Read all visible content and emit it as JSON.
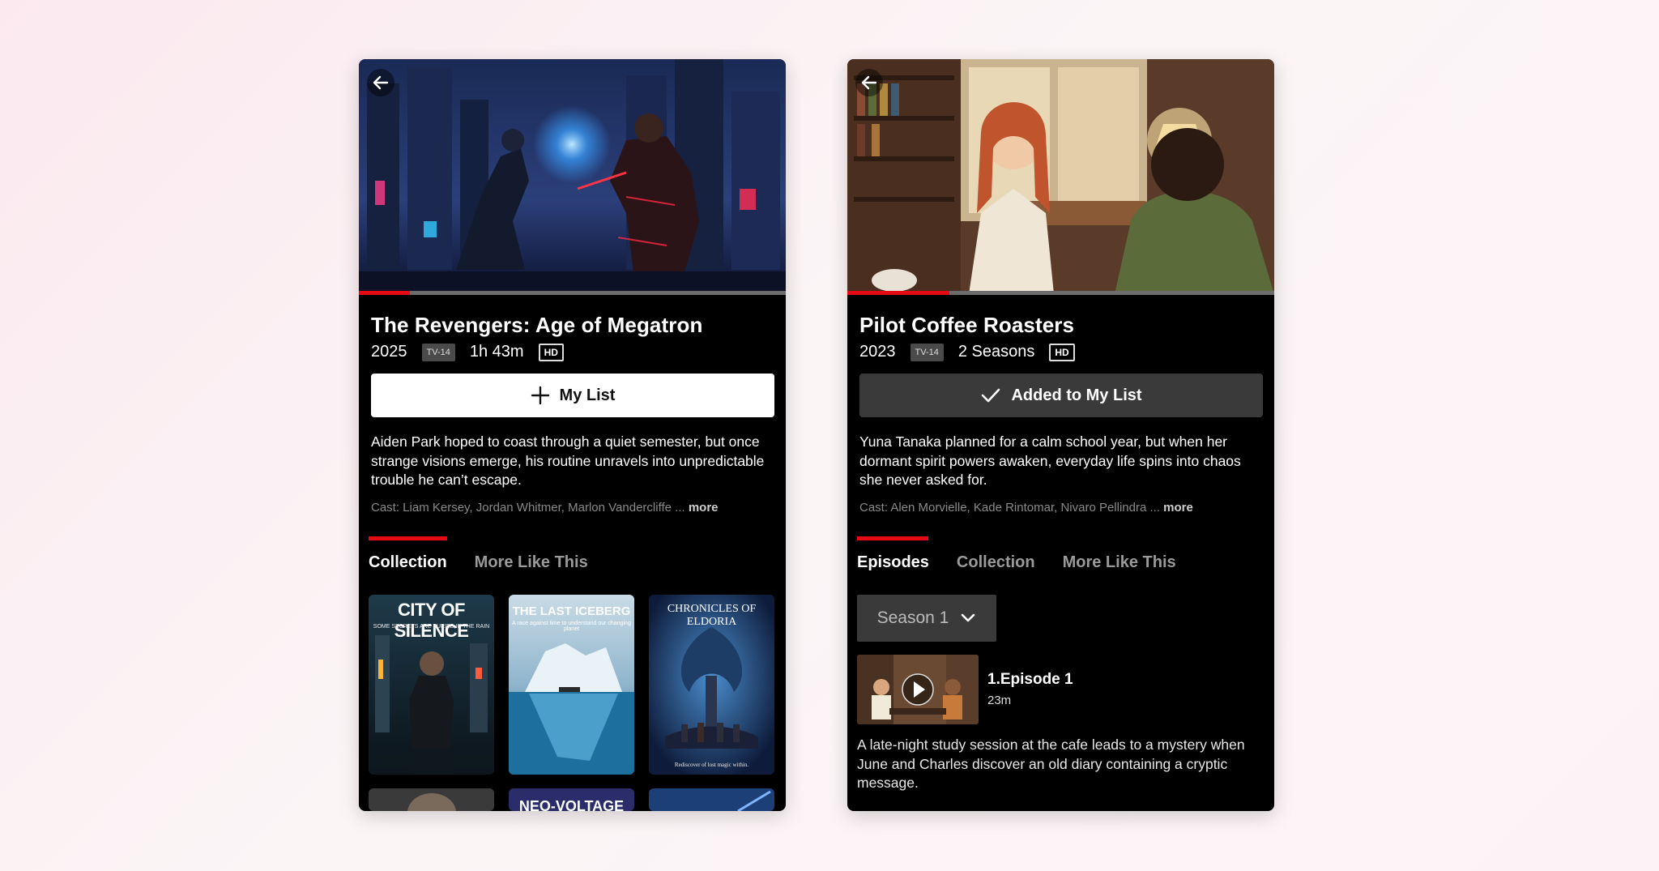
{
  "left_screen": {
    "title": "The Revengers: Age of Megatron",
    "year": "2025",
    "rating": "TV-14",
    "duration": "1h 43m",
    "quality": "HD",
    "list_button": "My List",
    "description": "Aiden Park hoped to coast through a quiet semester, but once strange visions emerge, his routine unravels into unpredictable trouble he can’t escape.",
    "cast": "Cast: Liam Kersey, Jordan Whitmer, Marlon Vandercliffe ...",
    "cast_more": "more",
    "tabs": [
      "Collection",
      "More Like This"
    ],
    "active_tab": "Collection",
    "playback_progress": 0.12,
    "posters": [
      {
        "title": "CITY OF SILENCE",
        "subtitle": "SOME SECRETS ARE BURIED IN THE RAIN"
      },
      {
        "title": "THE LAST ICEBERG",
        "subtitle": "A race against time to understand our changing planet"
      },
      {
        "title": "CHRONICLES OF ELDORIA",
        "subtitle": "Rediscover of lost magic within."
      },
      {
        "title": "",
        "subtitle": ""
      },
      {
        "title": "NEO-VOLTAGE",
        "subtitle": ""
      },
      {
        "title": "",
        "subtitle": ""
      }
    ]
  },
  "right_screen": {
    "title": "Pilot Coffee Roasters",
    "year": "2023",
    "rating": "TV-14",
    "seasons": "2 Seasons",
    "quality": "HD",
    "list_button": "Added to My List",
    "description": "Yuna Tanaka planned for a calm school year, but when her dormant spirit powers awaken, everyday life spins into chaos she never asked for.",
    "cast": "Cast: Alen Morvielle, Kade Rintomar, Nivaro Pellindra ...",
    "cast_more": "more",
    "tabs": [
      "Episodes",
      "Collection",
      "More Like This"
    ],
    "active_tab": "Episodes",
    "playback_progress": 0.24,
    "season_select": "Season 1",
    "episode": {
      "title": "1.Episode 1",
      "duration": "23m",
      "description": "A late-night study session at the cafe leads to a mystery when June and Charles discover an old diary containing a cryptic message."
    }
  },
  "colors": {
    "accent": "#e50914",
    "background": "#000000"
  },
  "icons": [
    "back-arrow-icon",
    "plus-icon",
    "check-icon",
    "chevron-down-icon",
    "play-icon"
  ]
}
